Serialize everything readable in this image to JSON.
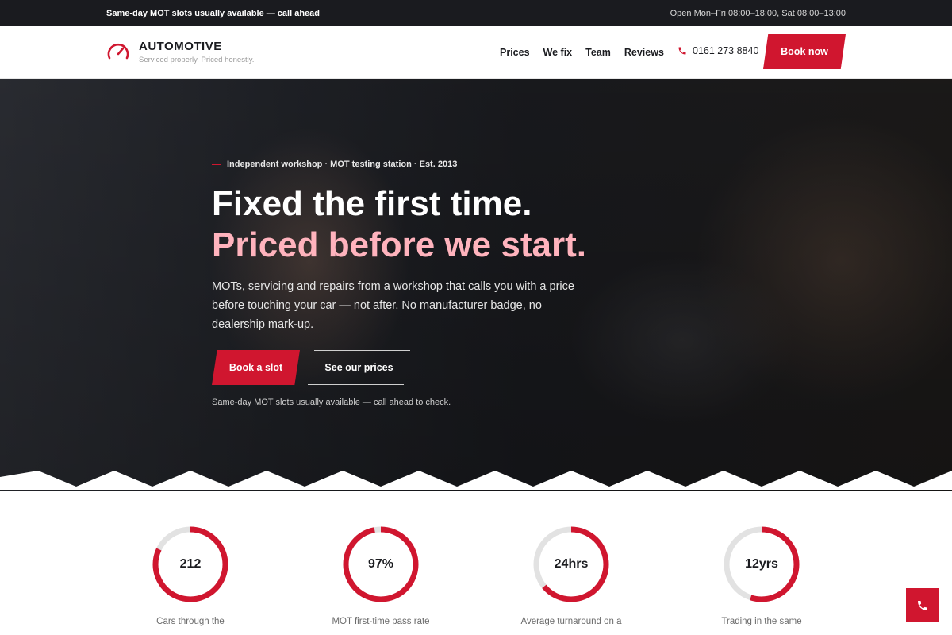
{
  "topbar": {
    "left": "Same-day MOT slots usually available — call ahead",
    "right": "Open Mon–Fri 08:00–18:00, Sat 08:00–13:00"
  },
  "nav": {
    "brand": "AUTOMOTIVE",
    "tagline": "Serviced properly. Priced honestly.",
    "links": [
      "Prices",
      "We fix",
      "Team",
      "Reviews"
    ],
    "phone": "0161 273 8840",
    "book_label": "Book now"
  },
  "hero": {
    "eyebrow": "Independent workshop · MOT testing station · Est. 2013",
    "headline_line1": "Fixed the first time.",
    "headline_line2": "Priced before we start.",
    "lead": "MOTs, servicing and repairs from a workshop that calls you with a price before touching your car — not after. No manufacturer badge, no dealership mark-up.",
    "cta_primary": "Book a slot",
    "cta_secondary": "See our prices",
    "note": "Same-day MOT slots usually available — call ahead to check."
  },
  "stats": [
    {
      "value": "212",
      "label": "Cars through the",
      "progress": 0.82
    },
    {
      "value": "97%",
      "label": "MOT first-time pass rate",
      "progress": 0.97
    },
    {
      "value": "24hrs",
      "label": "Average turnaround on a",
      "progress": 0.64
    },
    {
      "value": "12yrs",
      "label": "Trading in the same",
      "progress": 0.55
    }
  ],
  "colors": {
    "accent": "#d0162f",
    "headline_accent": "#ffb3bd",
    "dark": "#1a1b1f",
    "ring_track": "#e2e2e2"
  },
  "icons": {
    "logo": "speedometer-icon",
    "phone": "phone-icon",
    "fab": "phone-icon"
  }
}
